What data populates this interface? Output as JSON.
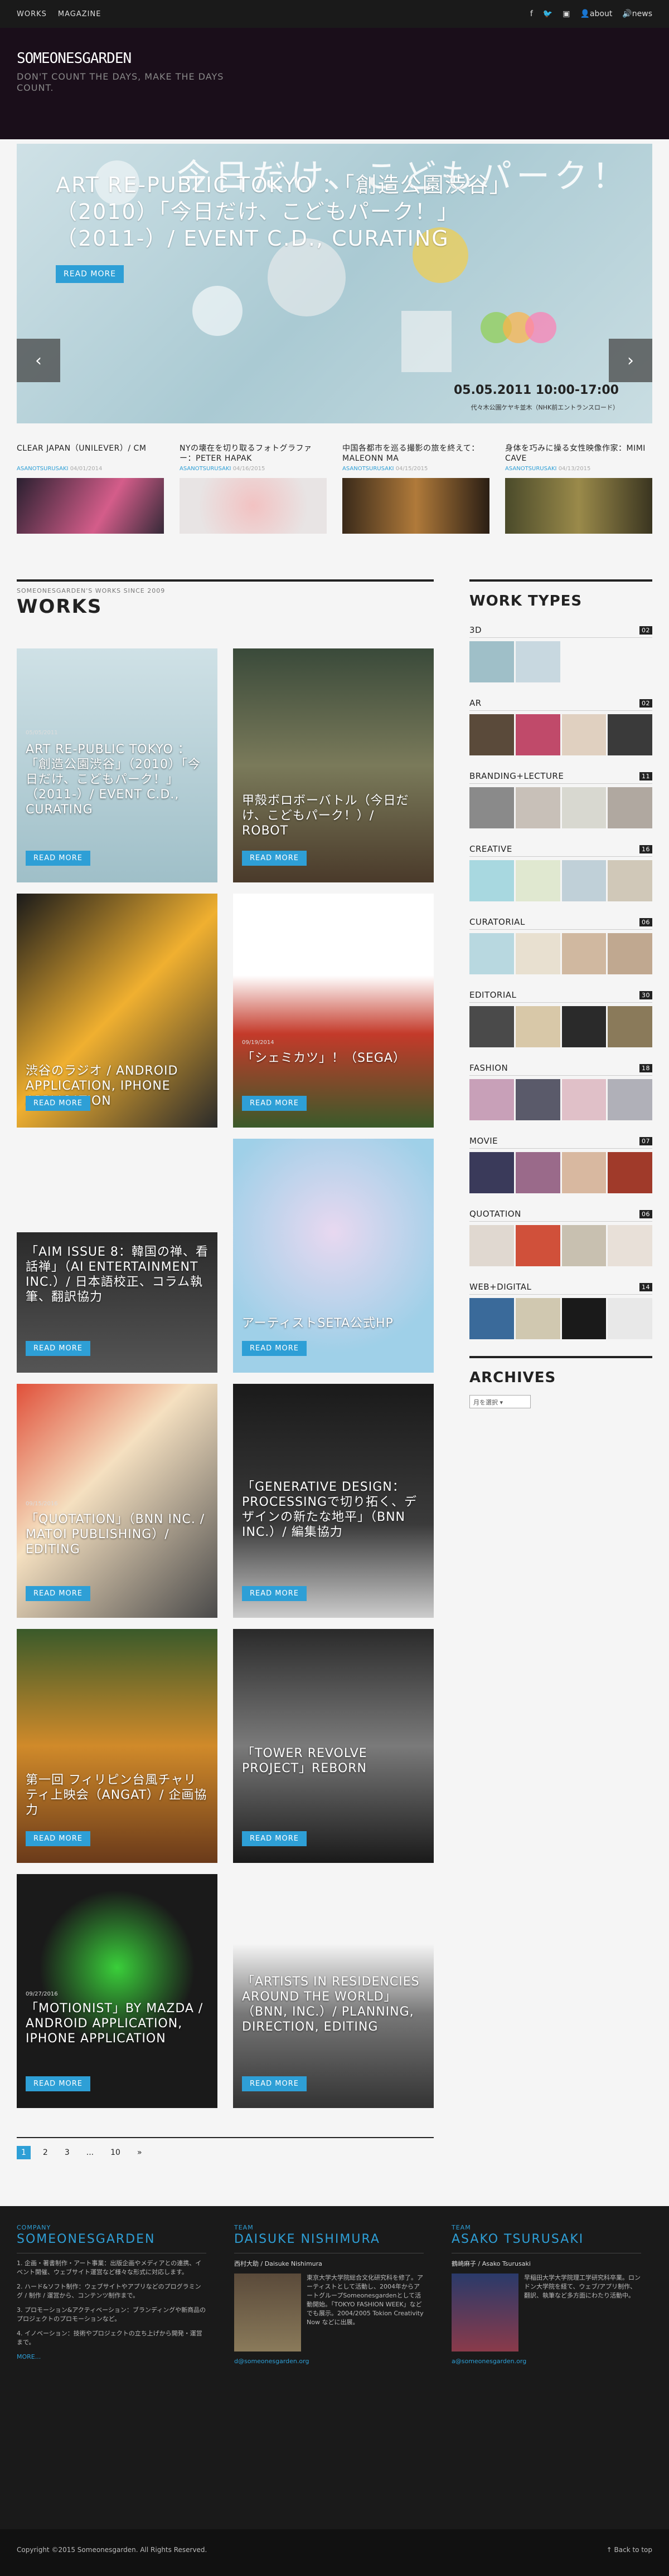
{
  "topbar": {
    "nav": [
      "WORKS",
      "MAGAZINE"
    ],
    "icons": [
      "facebook-icon",
      "twitter-icon",
      "instagram-icon"
    ],
    "about": "about",
    "news": "news"
  },
  "header": {
    "logo": "SOMEONESGARDEN",
    "tagline": "DON'T COUNT THE DAYS, MAKE THE DAYS COUNT."
  },
  "slider": {
    "title": "ART RE-PUBLIC TOKYO ：「創造公園渋谷」（2010）「今日だけ、こどもパーク！」（2011-）/ EVENT C.D., CURATING",
    "button": "READ MORE",
    "art_text": "今日だけ、こどもパーク！",
    "art_date": "05.05.2011 10:00-17:00",
    "art_sub": "代々木公園ケヤキ並木（NHK前エントランスロード）",
    "prev": "‹",
    "next": "›"
  },
  "subposts": [
    {
      "title": "CLEAR JAPAN（UNILEVER）/ CM",
      "author": "ASANOTSURUSAKI",
      "date": "04/01/2014"
    },
    {
      "title": "NYの壊在を切り取るフォトグラファー：PETER HAPAK",
      "author": "ASANOTSURUSAKI",
      "date": "04/16/2015"
    },
    {
      "title": "中国各都市を巡る撮影の旅を終えて：MALEONN MA",
      "author": "ASANOTSURUSAKI",
      "date": "04/15/2015"
    },
    {
      "title": "身体を巧みに操る女性映像作家：MIMI CAVE",
      "author": "ASANOTSURUSAKI",
      "date": "04/13/2015"
    }
  ],
  "main": {
    "since": "SOMEONESGARDEN'S WORKS SINCE 2009",
    "title": "WORKS",
    "cards": [
      {
        "date": "05/05/2011",
        "title": "ART RE-PUBLIC TOKYO ：「創造公園渋谷」（2010）「今日だけ、こどもパーク！」（2011-）/ EVENT C.D., CURATING",
        "button": "READ MORE"
      },
      {
        "date": "",
        "title": "甲殻ボロボーバトル（今日だけ、こどもパーク！）/ ROBOT",
        "button": "READ MORE"
      },
      {
        "date": "",
        "title": "渋谷のラジオ / ANDROID APPLICATION, IPHONE APPLICATION",
        "button": "READ MORE"
      },
      {
        "date": "09/19/2014",
        "title": "「シェミカツ」！（SEGA）",
        "button": "READ MORE"
      },
      {
        "date": "",
        "title": "「AIM ISSUE 8：韓国の禅、看話禅」（AI ENTERTAINMENT INC.）/ 日本語校正、コラム執筆、翻訳協力",
        "button": "READ MORE"
      },
      {
        "date": "",
        "title": "アーティストSETA公式HP",
        "button": "READ MORE"
      },
      {
        "date": "09/15/2016",
        "title": "「QUOTATION」（BNN INC. / MATOI PUBLISHING）/ EDITING",
        "button": "READ MORE"
      },
      {
        "date": "",
        "title": "「GENERATIVE DESIGN：PROCESSINGで切り拓く、デザインの新たな地平」（BNN INC.）/ 編集協力",
        "button": "READ MORE"
      },
      {
        "date": "",
        "title": "第一回 フィリピン台風チャリティ上映会（ANGAT）/ 企画協力",
        "button": "READ MORE"
      },
      {
        "date": "",
        "title": "「TOWER REVOLVE PROJECT」REBORN",
        "button": "READ MORE"
      },
      {
        "date": "09/27/2016",
        "title": "「MOTIONIST」BY MAZDA / ANDROID APPLICATION, IPHONE APPLICATION",
        "button": "READ MORE"
      },
      {
        "date": "",
        "title": "「ARTISTS IN RESIDENCIES AROUND THE WORLD」（BNN, INC.）/ PLANNING, DIRECTION, EDITING",
        "button": "READ MORE"
      }
    ]
  },
  "pager": [
    "1",
    "2",
    "3",
    "...",
    "10",
    "»"
  ],
  "sidebar": {
    "types_title": "WORK TYPES",
    "types": [
      {
        "name": "3D",
        "count": "02"
      },
      {
        "name": "AR",
        "count": "02"
      },
      {
        "name": "BRANDING+LECTURE",
        "count": "11"
      },
      {
        "name": "CREATIVE",
        "count": "16"
      },
      {
        "name": "CURATORIAL",
        "count": "06"
      },
      {
        "name": "EDITORIAL",
        "count": "30"
      },
      {
        "name": "FASHION",
        "count": "18"
      },
      {
        "name": "MOVIE",
        "count": "07"
      },
      {
        "name": "QUOTATION",
        "count": "06"
      },
      {
        "name": "WEB+DIGITAL",
        "count": "14"
      }
    ],
    "archives_title": "ARCHIVES",
    "archives_select": "月を選択"
  },
  "footer": {
    "col1": {
      "label": "COMPANY",
      "heading": "SOMEONESGARDEN",
      "items": [
        "1. 企画・著書制作・アート事業：出版企画やメディアとの連携、イベント開催、ウェブサイト運営など様々な形式に対応します。",
        "2. ハード&ソフト制作：ウェブサイトやアプリなどのプログラミング / 制作 / 運営から、コンテンツ制作まで。",
        "3. プロモーション&アクティベーション：ブランディングや新商品のプロジェクトのプロモーションなど。",
        "4. イノベーション：技術やプロジェクトの立ち上げから開発・運営まで。"
      ],
      "more": "MORE..."
    },
    "col2": {
      "label": "TEAM",
      "heading": "DAISUKE NISHIMURA",
      "name": "西村大助 / Daisuke Nishimura",
      "bio": "東京大学大学院総合文化研究科を修了。アーティストとして活動し、2004年からアートグループSomeonesgardenとして活動開始。「TOKYO FASHION WEEK」などでも展示。2004/2005 Tokion Creativity Now などに出展。",
      "email": "d@someonesgarden.org"
    },
    "col3": {
      "label": "TEAM",
      "heading": "ASAKO TSURUSAKI",
      "name": "鶴崎麻子 / Asako Tsurusaki",
      "bio": "早稲田大学大学院理工学研究科卒業。ロンドン大学院を経て、ウェブ/アプリ制作、翻訳、執筆など多方面にわたり活動中。",
      "email": "a@someonesgarden.org"
    }
  },
  "footbar": {
    "copyright": "Copyright ©2015 Someonesgarden. All Rights Reserved.",
    "back": "↑ Back to top"
  }
}
